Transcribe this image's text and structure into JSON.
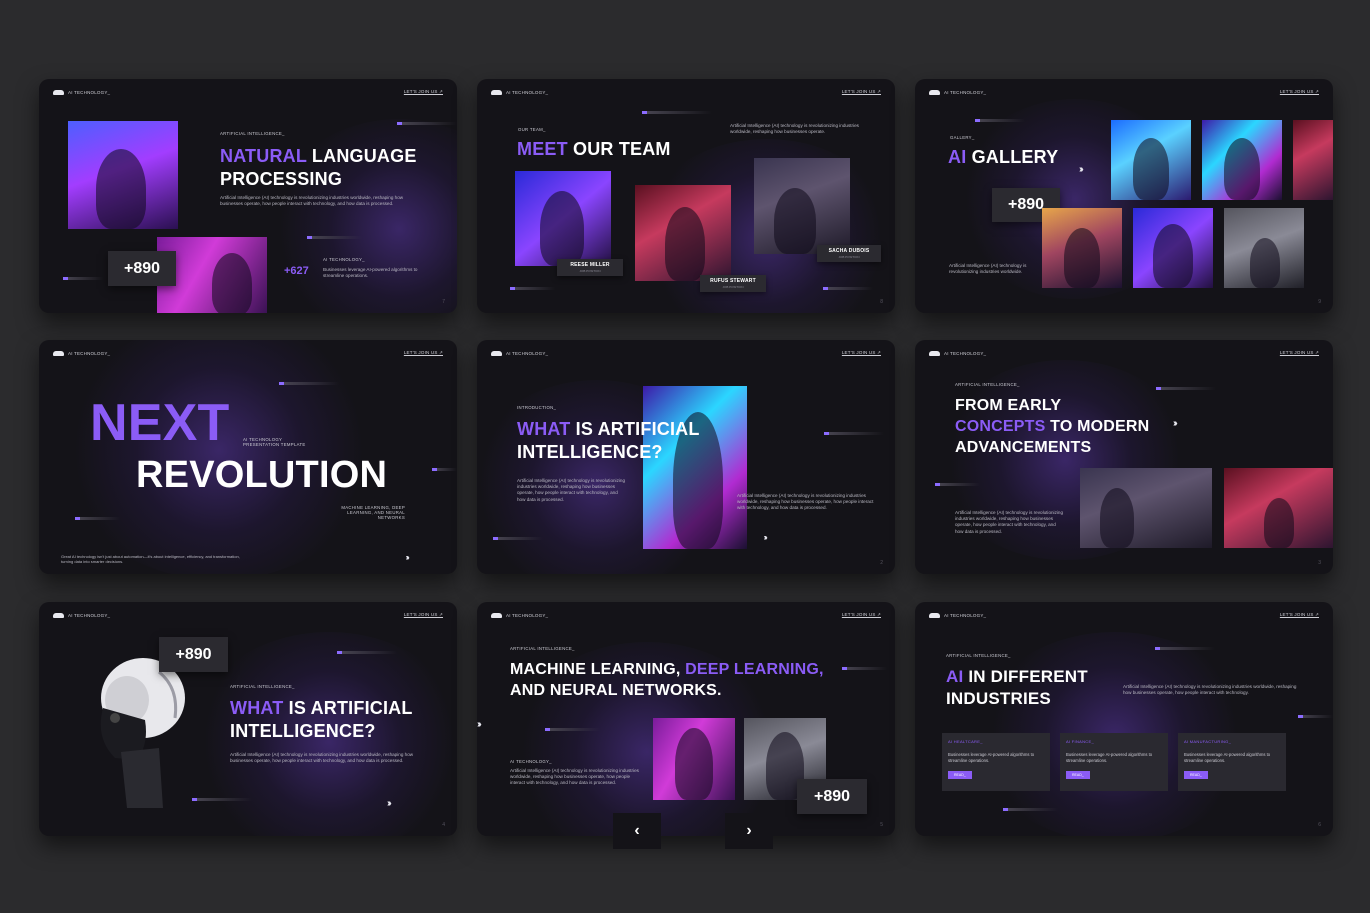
{
  "common": {
    "brand": "AI TECHNOLOGY_",
    "join": "LET'S JOIN US ↗"
  },
  "slide1": {
    "eyebrow": "ARTIFICIAL INTELLIGENCE_",
    "title_accent": "NATURAL",
    "title_rest1": " LANGUAGE",
    "title_rest2": "PROCESSING",
    "body": "Artificial Intelligence (AI) technology is revolutionizing industries worldwide, reshaping how businesses operate, how people interact with technology, and how data is processed.",
    "badge": "+890",
    "sublabel": "AI TECHNOLOGY_",
    "stat": "+627",
    "stat_text": "Businesses leverage AI-powered algorithms to streamline operations.",
    "page": "7"
  },
  "slide2": {
    "eyebrow": "OUR TEAM_",
    "title_accent": "MEET",
    "title_rest": " OUR TEAM",
    "body": "Artificial Intelligence (AI) technology is revolutionizing industries worldwide, reshaping how businesses operate.",
    "members": [
      {
        "name": "REESE MILLER",
        "role": "JOB POSITION"
      },
      {
        "name": "RUFUS STEWART",
        "role": "JOB POSITION"
      },
      {
        "name": "SACHA DUBOIS",
        "role": "JOB POSITION"
      }
    ],
    "page": "8"
  },
  "slide3": {
    "eyebrow": "GALLERY_",
    "title_accent": "AI",
    "title_rest": " GALLERY",
    "badge": "+890",
    "body": "Artificial Intelligence (AI) technology is revolutionizing industries worldwide.",
    "page": "9"
  },
  "slide4": {
    "title_line1": "NEXT",
    "title_line2": "REVOLUTION",
    "tag_line1": "AI TECHNOLOGY",
    "tag_line2": "PRESENTATION TEMPLATE",
    "topics": "MACHINE LEARNING, DEEP LEARNING, AND NEURAL NETWORKS",
    "footer": "Great AI technology isn't just about automation—it's about intelligence, efficiency, and transformation, turning data into smarter decisions."
  },
  "slide5": {
    "eyebrow": "INTRODUCTION_",
    "title_accent": "WHAT",
    "title_rest1": " IS ARTIFICIAL",
    "title_rest2": "INTELLIGENCE?",
    "body_left": "Artificial Intelligence (AI) technology is revolutionizing industries worldwide, reshaping how businesses operate, how people interact with technology, and how data is processed.",
    "body_right": "Artificial Intelligence (AI) technology is revolutionizing industries worldwide, reshaping how businesses operate, how people interact with technology, and how data is processed.",
    "page": "2"
  },
  "slide6": {
    "eyebrow": "ARTIFICIAL INTELLIGENCE_",
    "title_line1": "FROM EARLY",
    "title_accent": "CONCEPTS",
    "title_rest": " TO MODERN",
    "title_line3": "ADVANCEMENTS",
    "body": "Artificial Intelligence (AI) technology is revolutionizing industries worldwide, reshaping how businesses operate, how people interact with technology, and how data is processed.",
    "page": "3"
  },
  "slide7": {
    "badge": "+890",
    "eyebrow": "ARTIFICIAL INTELLIGENCE_",
    "title_accent": "WHAT",
    "title_rest1": " IS ARTIFICIAL",
    "title_rest2": "INTELLIGENCE?",
    "body": "Artificial Intelligence (AI) technology is revolutionizing industries worldwide, reshaping how businesses operate, how people interact with technology, and how data is processed.",
    "page": "4"
  },
  "slide8": {
    "eyebrow": "ARTIFICIAL INTELLIGENCE_",
    "title_pre": "MACHINE LEARNING, ",
    "title_accent": "DEEP LEARNING,",
    "title_line2": "AND NEURAL NETWORKS.",
    "sublabel": "AI TECHNOLOGY_",
    "body": "Artificial Intelligence (AI) technology is revolutionizing industries worldwide, reshaping how businesses operate, how people interact with technology, and how data is processed.",
    "badge": "+890",
    "prev": "‹",
    "next": "›",
    "page": "5"
  },
  "slide9": {
    "eyebrow": "ARTIFICIAL INTELLIGENCE_",
    "title_accent": "AI",
    "title_rest1": " IN DIFFERENT",
    "title_rest2": "INDUSTRIES",
    "body": "Artificial Intelligence (AI) technology is revolutionizing industries worldwide, reshaping how businesses operate, how people interact with technology.",
    "cards": [
      {
        "title": "AI HEALTCARE_",
        "text": "Businesses leverage AI-powered algorithms to streamline operations.",
        "button": "READ_"
      },
      {
        "title": "AI FINANCE_",
        "text": "Businesses leverage AI-powered algorithms to streamline operations.",
        "button": "READ_"
      },
      {
        "title": "AI MANUFACTURING_",
        "text": "Businesses leverage AI-powered algorithms to streamline operations.",
        "button": "READ_"
      }
    ],
    "page": "6"
  }
}
